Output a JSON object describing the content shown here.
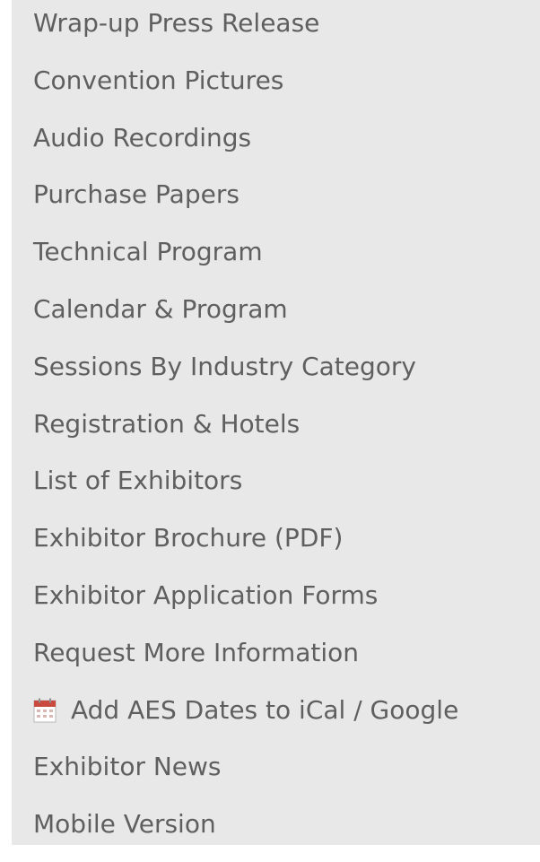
{
  "sidebar": {
    "items": [
      {
        "label": "Wrap-up Press Release"
      },
      {
        "label": "Convention Pictures"
      },
      {
        "label": "Audio Recordings"
      },
      {
        "label": "Purchase Papers"
      },
      {
        "label": "Technical Program"
      },
      {
        "label": "Calendar & Program"
      },
      {
        "label": "Sessions By Industry Category"
      },
      {
        "label": "Registration & Hotels"
      },
      {
        "label": "List of Exhibitors"
      },
      {
        "label": "Exhibitor Brochure (PDF)"
      },
      {
        "label": "Exhibitor Application Forms"
      },
      {
        "label": "Request More Information"
      },
      {
        "label": "Add AES Dates to iCal / Google",
        "icon": "calendar-icon"
      },
      {
        "label": "Exhibitor News"
      },
      {
        "label": "Mobile Version"
      }
    ]
  },
  "colors": {
    "panel_background": "#e8e8e8",
    "link_text": "#5f5f5f",
    "calendar_icon_red": "#c94a3f"
  }
}
